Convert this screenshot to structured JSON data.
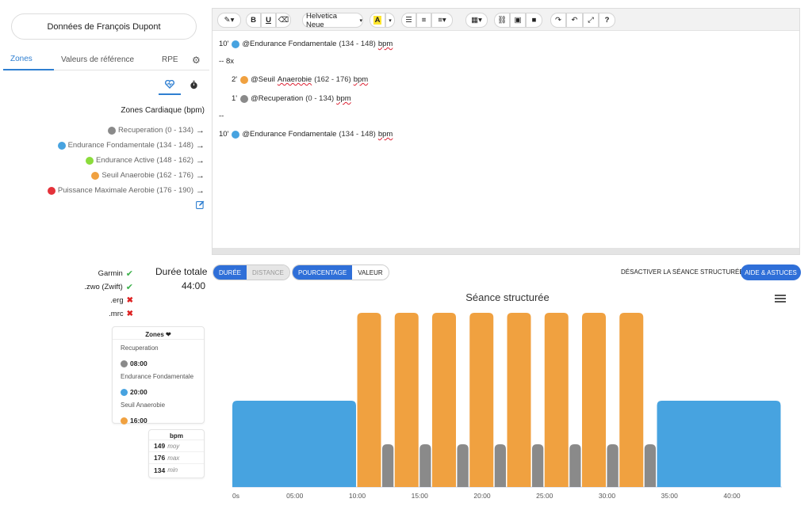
{
  "athlete": {
    "title": "Données de François Dupont"
  },
  "tabs": {
    "zones": "Zones",
    "reference": "Valeurs de référence",
    "rpe": "RPE"
  },
  "zones_panel": {
    "title": "Zones Cardiaque (bpm)",
    "zones": [
      {
        "name": "Recuperation",
        "range": "(0 - 134)",
        "color": "#8a8a8a"
      },
      {
        "name": "Endurance Fondamentale",
        "range": "(134 - 148)",
        "color": "#47a3e0"
      },
      {
        "name": "Endurance Active",
        "range": "(148 - 162)",
        "color": "#8bdc3c"
      },
      {
        "name": "Seuil Anaerobie",
        "range": "(162 - 176)",
        "color": "#f0a140"
      },
      {
        "name": "Puissance Maximale Aerobie",
        "range": "(176 - 190)",
        "color": "#e4323a"
      }
    ]
  },
  "toolbar": {
    "font": "Helvetica Neue",
    "bold": "B",
    "underline": "U",
    "help": "?"
  },
  "editor": {
    "l1_dur": "10'",
    "l1_zone": "@Endurance Fondamentale",
    "l1_range": "(134 - 148)",
    "l1_unit": "bpm",
    "l2": "-- 8x",
    "l3_dur": "2'",
    "l3_zone_a": "@Seuil",
    "l3_zone_b": "Anaerobie",
    "l3_range": "(162 - 176)",
    "l3_unit": "bpm",
    "l4_dur": "1'",
    "l4_zone": "@Recuperation",
    "l4_range": "(0 - 134)",
    "l4_unit": "bpm",
    "l5": "--",
    "l6_dur": "10'",
    "l6_zone": "@Endurance Fondamentale",
    "l6_range": "(134 - 148)",
    "l6_unit": "bpm"
  },
  "exports": [
    {
      "label": "Garmin",
      "ok": true
    },
    {
      "label": ".zwo (Zwift)",
      "ok": true
    },
    {
      "label": ".erg",
      "ok": false
    },
    {
      "label": ".mrc",
      "ok": false
    }
  ],
  "duration": {
    "label": "Durée totale",
    "value": "44:00"
  },
  "zones_card": {
    "title": "Zones",
    "items": [
      {
        "name": "Recuperation",
        "time": "08:00",
        "color": "#8a8a8a"
      },
      {
        "name": "Endurance Fondamentale",
        "time": "20:00",
        "color": "#47a3e0"
      },
      {
        "name": "Seuil Anaerobie",
        "time": "16:00",
        "color": "#f0a140"
      }
    ]
  },
  "bpm_card": {
    "title": "bpm",
    "avg": "149",
    "avg_label": "moy",
    "max": "176",
    "max_label": "max",
    "min": "134",
    "min_label": "min"
  },
  "controls": {
    "duree": "DURÉE",
    "distance": "DISTANCE",
    "pourcentage": "POURCENTAGE",
    "valeur": "VALEUR",
    "disable": "DÉSACTIVER LA SÉANCE STRUCTURÉE",
    "help": "AIDE & ASTUCES"
  },
  "chart_data": {
    "type": "bar",
    "title": "Séance structurée",
    "x_unit": "minutes",
    "xlim": [
      0,
      44
    ],
    "x_ticks": [
      "0s",
      "05:00",
      "10:00",
      "15:00",
      "20:00",
      "25:00",
      "30:00",
      "35:00",
      "40:00"
    ],
    "segments": [
      {
        "start": 0,
        "end": 10,
        "zone": "Endurance Fondamentale",
        "level": 2,
        "color": "#47a3e0"
      },
      {
        "start": 10,
        "end": 12,
        "zone": "Seuil Anaerobie",
        "level": 4,
        "color": "#f0a140"
      },
      {
        "start": 12,
        "end": 13,
        "zone": "Recuperation",
        "level": 1,
        "color": "#8a8a8a"
      },
      {
        "start": 13,
        "end": 15,
        "zone": "Seuil Anaerobie",
        "level": 4,
        "color": "#f0a140"
      },
      {
        "start": 15,
        "end": 16,
        "zone": "Recuperation",
        "level": 1,
        "color": "#8a8a8a"
      },
      {
        "start": 16,
        "end": 18,
        "zone": "Seuil Anaerobie",
        "level": 4,
        "color": "#f0a140"
      },
      {
        "start": 18,
        "end": 19,
        "zone": "Recuperation",
        "level": 1,
        "color": "#8a8a8a"
      },
      {
        "start": 19,
        "end": 21,
        "zone": "Seuil Anaerobie",
        "level": 4,
        "color": "#f0a140"
      },
      {
        "start": 21,
        "end": 22,
        "zone": "Recuperation",
        "level": 1,
        "color": "#8a8a8a"
      },
      {
        "start": 22,
        "end": 24,
        "zone": "Seuil Anaerobie",
        "level": 4,
        "color": "#f0a140"
      },
      {
        "start": 24,
        "end": 25,
        "zone": "Recuperation",
        "level": 1,
        "color": "#8a8a8a"
      },
      {
        "start": 25,
        "end": 27,
        "zone": "Seuil Anaerobie",
        "level": 4,
        "color": "#f0a140"
      },
      {
        "start": 27,
        "end": 28,
        "zone": "Recuperation",
        "level": 1,
        "color": "#8a8a8a"
      },
      {
        "start": 28,
        "end": 30,
        "zone": "Seuil Anaerobie",
        "level": 4,
        "color": "#f0a140"
      },
      {
        "start": 30,
        "end": 31,
        "zone": "Recuperation",
        "level": 1,
        "color": "#8a8a8a"
      },
      {
        "start": 31,
        "end": 33,
        "zone": "Seuil Anaerobie",
        "level": 4,
        "color": "#f0a140"
      },
      {
        "start": 33,
        "end": 34,
        "zone": "Recuperation",
        "level": 1,
        "color": "#8a8a8a"
      },
      {
        "start": 34,
        "end": 44,
        "zone": "Endurance Fondamentale",
        "level": 2,
        "color": "#47a3e0"
      }
    ]
  }
}
